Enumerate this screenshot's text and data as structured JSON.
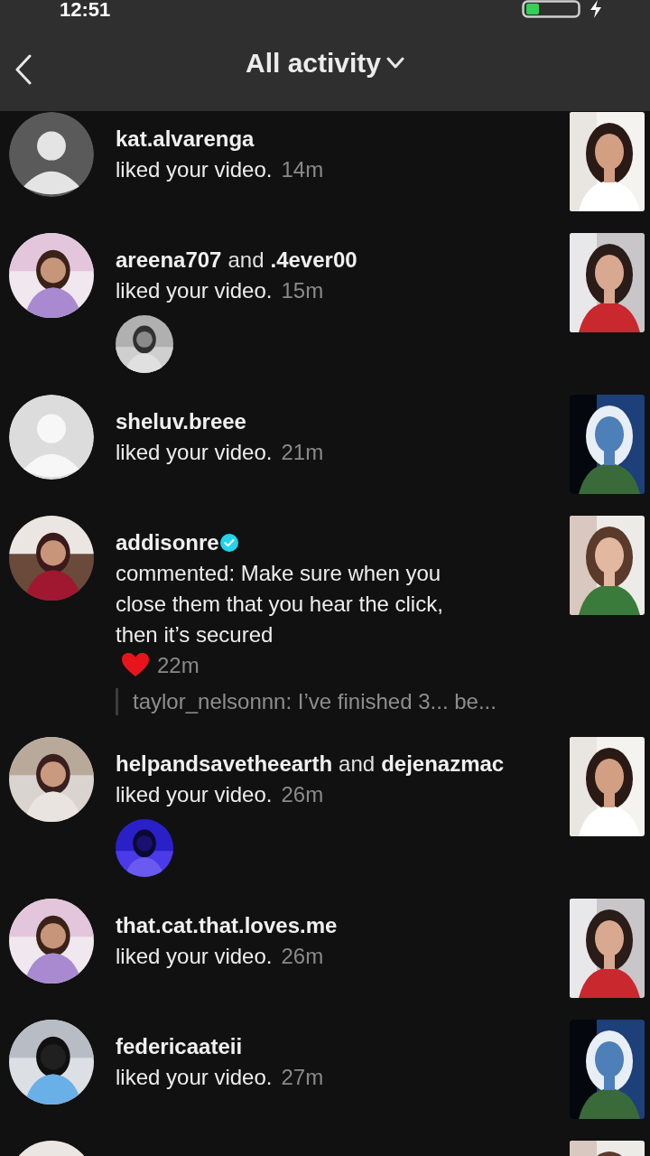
{
  "status_bar": {
    "time": "12:51"
  },
  "header": {
    "title": "All activity"
  },
  "notifications": [
    {
      "users": [
        {
          "name": "kat.alvarenga",
          "verified": false
        }
      ],
      "action": "liked your video.",
      "time": "14m",
      "avatar": {
        "kind": "silhouette"
      },
      "thumbnail": {
        "kind": "picture"
      }
    },
    {
      "users": [
        {
          "name": "areena707",
          "verified": false
        },
        {
          "name": ".4ever00",
          "verified": false
        }
      ],
      "joiner": "and",
      "action": "liked your video.",
      "time": "15m",
      "avatar": {
        "kind": "picture"
      },
      "extra_avatar": {
        "kind": "picture"
      },
      "thumbnail": {
        "kind": "picture"
      }
    },
    {
      "users": [
        {
          "name": "sheluv.breee",
          "verified": false
        }
      ],
      "action": "liked your video.",
      "time": "21m",
      "avatar": {
        "kind": "pale"
      },
      "thumbnail": {
        "kind": "picture"
      }
    },
    {
      "users": [
        {
          "name": "addisonre",
          "verified": true
        }
      ],
      "action": "commented: Make sure when you close them that you hear the click, then it’s secured",
      "emoji": {
        "kind": "heart"
      },
      "time": "22m",
      "reply": "taylor_nelsonnn: I’ve finished 3... be...",
      "avatar": {
        "kind": "picture"
      },
      "thumbnail": {
        "kind": "picture"
      }
    },
    {
      "users": [
        {
          "name": "helpandsavetheearth",
          "verified": false
        },
        {
          "name": "dejenazmac",
          "verified": false
        }
      ],
      "joiner": "and",
      "action": "liked your video.",
      "time": "26m",
      "avatar": {
        "kind": "picture"
      },
      "extra_avatar": {
        "kind": "picture"
      },
      "thumbnail": {
        "kind": "picture"
      }
    },
    {
      "users": [
        {
          "name": "that.cat.that.loves.me",
          "verified": false
        }
      ],
      "action": "liked your video.",
      "time": "26m",
      "avatar": {
        "kind": "picture"
      },
      "thumbnail": {
        "kind": "picture"
      }
    },
    {
      "users": [
        {
          "name": "federicaateii",
          "verified": false
        }
      ],
      "action": "liked your video.",
      "time": "27m",
      "avatar": {
        "kind": "picture"
      },
      "thumbnail": {
        "kind": "picture"
      }
    },
    {
      "avatar": {
        "kind": "picture"
      },
      "thumbnail": {
        "kind": "picture"
      }
    }
  ]
}
